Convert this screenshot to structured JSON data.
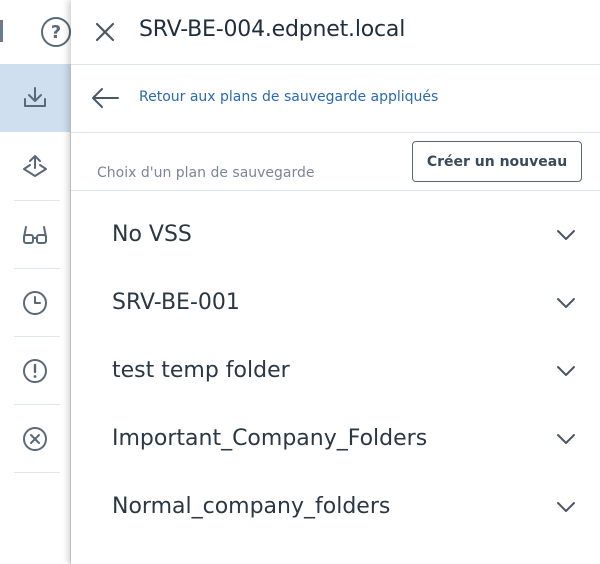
{
  "background": {
    "help_glyph": "?",
    "sidebar": {
      "items": [
        {
          "icon": "download-icon",
          "active": true
        },
        {
          "icon": "upload-icon",
          "active": false
        },
        {
          "icon": "glasses-icon",
          "active": false
        },
        {
          "icon": "clock-icon",
          "active": false
        },
        {
          "icon": "alert-circle-icon",
          "active": false
        },
        {
          "icon": "cancel-circle-icon",
          "active": false
        }
      ]
    }
  },
  "panel": {
    "title": "SRV-BE-004.edpnet.local",
    "back_link": "Retour aux plans de sauvegarde appliqués",
    "choose_label": "Choix d'un plan de sauvegarde",
    "create_button": "Créer un nouveau",
    "plans": [
      {
        "name": "No VSS"
      },
      {
        "name": "SRV-BE-001"
      },
      {
        "name": "test temp folder"
      },
      {
        "name": "Important_Company_Folders"
      },
      {
        "name": "Normal_company_folders"
      }
    ]
  },
  "colors": {
    "accent": "#2a6ab2",
    "active_sidebar": "#cfdff0",
    "icon": "#5a6978",
    "text": "#2a3744"
  }
}
